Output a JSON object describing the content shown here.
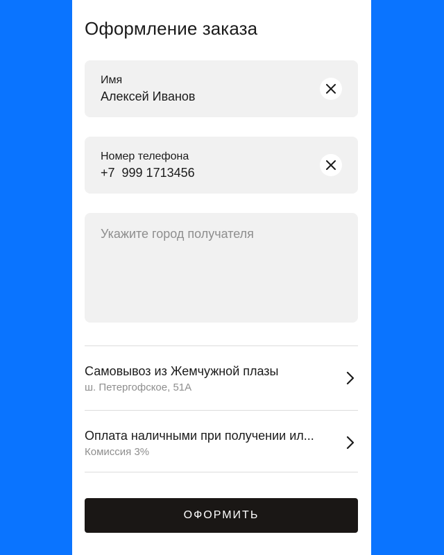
{
  "page": {
    "title": "Оформление заказа"
  },
  "form": {
    "name": {
      "label": "Имя",
      "value": "Алексей Иванов",
      "clear_icon": "close-icon"
    },
    "phone": {
      "label": "Номер телефона",
      "value": "+7  999 1713456",
      "clear_icon": "close-icon"
    },
    "city": {
      "placeholder": "Укажите город получателя",
      "value": ""
    }
  },
  "options": {
    "delivery": {
      "title": "Самовывоз из Жемчужной плазы",
      "subtitle": "ш. Петергофское, 51А",
      "icon": "chevron-right-icon"
    },
    "payment": {
      "title": "Оплата наличными при получении ил...",
      "subtitle": "Комиссия 3%",
      "icon": "chevron-right-icon"
    }
  },
  "actions": {
    "submit_label": "ОФОРМИТЬ"
  },
  "colors": {
    "background": "#0a74ff",
    "surface": "#ffffff",
    "field_bg": "#f1f1f1",
    "button_bg": "#1a1715",
    "text": "#1b1b1b",
    "muted_text": "#8e8e8e"
  }
}
